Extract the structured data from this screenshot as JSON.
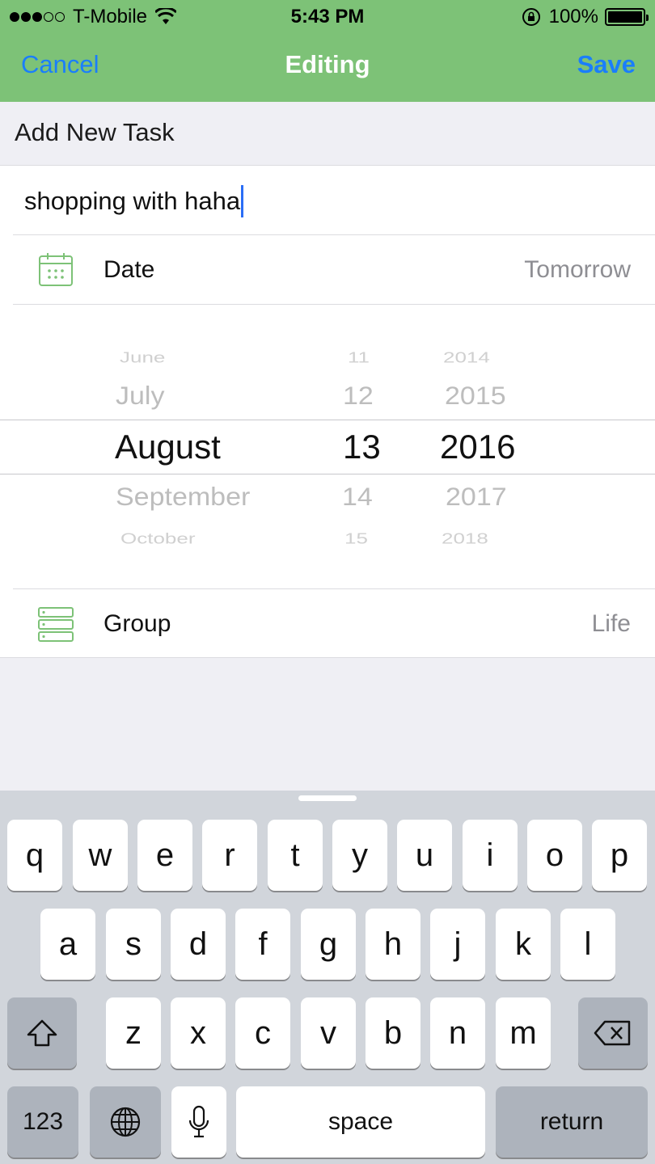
{
  "status_bar": {
    "carrier": "T-Mobile",
    "time": "5:43 PM",
    "battery": "100%",
    "signal_bars_filled": 3,
    "signal_bars_total": 5
  },
  "nav": {
    "cancel": "Cancel",
    "title": "Editing",
    "save": "Save"
  },
  "section_title": "Add New Task",
  "task": {
    "text": "shopping with haha"
  },
  "date_row": {
    "icon": "calendar-icon",
    "label": "Date",
    "value": "Tomorrow"
  },
  "picker": {
    "months": [
      "June",
      "July",
      "August",
      "September",
      "October"
    ],
    "days": [
      "11",
      "12",
      "13",
      "14",
      "15"
    ],
    "years": [
      "2014",
      "2015",
      "2016",
      "2017",
      "2018"
    ],
    "selected": {
      "month": "August",
      "day": "13",
      "year": "2016"
    }
  },
  "group_row": {
    "icon": "list-icon",
    "label": "Group",
    "value": "Life"
  },
  "keyboard": {
    "row1": [
      "q",
      "w",
      "e",
      "r",
      "t",
      "y",
      "u",
      "i",
      "o",
      "p"
    ],
    "row2": [
      "a",
      "s",
      "d",
      "f",
      "g",
      "h",
      "j",
      "k",
      "l"
    ],
    "row3": [
      "z",
      "x",
      "c",
      "v",
      "b",
      "n",
      "m"
    ],
    "numbers": "123",
    "space": "space",
    "return": "return"
  },
  "colors": {
    "header_green": "#7dc277",
    "link_blue": "#1a7efb",
    "icon_green": "#7dc277"
  }
}
